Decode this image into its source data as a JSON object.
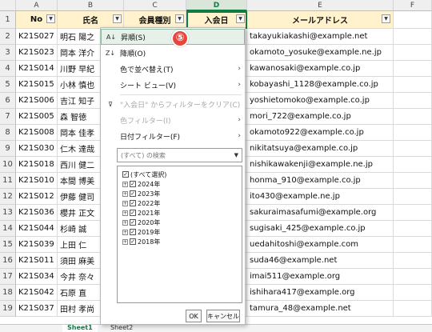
{
  "columns": [
    "A",
    "B",
    "C",
    "D",
    "E",
    "F"
  ],
  "header_row": {
    "row_num": "1",
    "no": "No",
    "name": "氏名",
    "member_type": "会員種別",
    "join_date": "入会日",
    "email": "メールアドレス"
  },
  "rows": [
    {
      "row_num": "2",
      "no": "K21S027",
      "name": "明石 陽之",
      "email": "takayukiakashi@example.net"
    },
    {
      "row_num": "3",
      "no": "K21S023",
      "name": "岡本 洋介",
      "email": "okamoto_yosuke@example.ne.jp"
    },
    {
      "row_num": "4",
      "no": "K21S014",
      "name": "川野 早紀",
      "email": "kawanosaki@example.co.jp"
    },
    {
      "row_num": "5",
      "no": "K21S015",
      "name": "小林 慎也",
      "email": "kobayashi_1128@example.co.jp"
    },
    {
      "row_num": "6",
      "no": "K21S006",
      "name": "吉江 知子",
      "email": "yoshietomoko@example.co.jp"
    },
    {
      "row_num": "7",
      "no": "K21S005",
      "name": "森 智徳",
      "email": "mori_722@example.co.jp"
    },
    {
      "row_num": "8",
      "no": "K21S008",
      "name": "岡本 佳孝",
      "email": "okamoto922@example.co.jp"
    },
    {
      "row_num": "9",
      "no": "K21S030",
      "name": "仁木 達哉",
      "email": "nikitatsuya@example.co.jp"
    },
    {
      "row_num": "10",
      "no": "K21S018",
      "name": "西川 健二",
      "email": "nishikawakenji@example.ne.jp"
    },
    {
      "row_num": "11",
      "no": "K21S010",
      "name": "本間 博美",
      "email": "honma_910@example.co.jp"
    },
    {
      "row_num": "12",
      "no": "K21S012",
      "name": "伊藤 健司",
      "email": "ito430@example.ne.jp"
    },
    {
      "row_num": "13",
      "no": "K21S036",
      "name": "櫻井 正文",
      "email": "sakuraimasafumi@example.org"
    },
    {
      "row_num": "14",
      "no": "K21S044",
      "name": "杉崎 誠",
      "email": "sugisaki_425@example.co.jp"
    },
    {
      "row_num": "15",
      "no": "K21S039",
      "name": "上田 仁",
      "email": "uedahitoshi@example.com"
    },
    {
      "row_num": "16",
      "no": "K21S011",
      "name": "須田 麻美",
      "email": "suda46@example.net"
    },
    {
      "row_num": "17",
      "no": "K21S034",
      "name": "今井 奈々",
      "email": "imai511@example.org"
    },
    {
      "row_num": "18",
      "no": "K21S042",
      "name": "石原 直",
      "email": "ishihara417@example.org"
    },
    {
      "row_num": "19",
      "no": "K21S037",
      "name": "田村 孝尚",
      "email": "tamura_48@example.net"
    }
  ],
  "filter_menu": {
    "sort_asc": "昇順(S)",
    "sort_desc": "降順(O)",
    "sort_by_color": "色で並べ替え(T)",
    "sheet_view": "シート ビュー(V)",
    "clear_filter": "\"入会日\" からフィルターをクリア(C)",
    "color_filter": "色フィルター(I)",
    "date_filter": "日付フィルター(F)",
    "search_placeholder": "(すべて) の検索",
    "select_all": "(すべて選択)",
    "years": [
      "2024年",
      "2023年",
      "2022年",
      "2021年",
      "2020年",
      "2019年",
      "2018年"
    ],
    "ok": "OK",
    "cancel": "キャンセル"
  },
  "badge": "⑤",
  "sheet_tabs": [
    "Sheet1",
    "Sheet2"
  ],
  "colors": {
    "header_fill": "#fff2cc",
    "selected_green": "#107c41",
    "badge_red": "#e8463c"
  }
}
